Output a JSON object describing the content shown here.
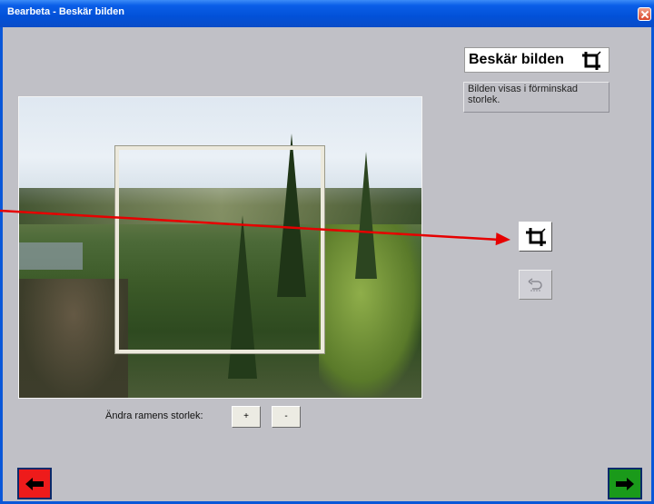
{
  "window": {
    "title": "Bearbeta - Beskär bilden"
  },
  "panel": {
    "heading": "Beskär bilden",
    "info": "Bilden visas i förminskad storlek."
  },
  "resize": {
    "label": "Ändra ramens storlek:",
    "plus": "+",
    "minus": "-"
  },
  "icons": {
    "heading": "crop-icon",
    "crop_button": "crop-icon",
    "undo_button": "undo-icon",
    "back": "arrow-left-icon",
    "next": "arrow-right-icon",
    "close": "close-icon"
  },
  "colors": {
    "titlebar": "#0a57d8",
    "client": "#c0c0c6",
    "back_button": "#ee1b1b",
    "next_button": "#1a9a1a",
    "pointer_line": "#e60000"
  }
}
